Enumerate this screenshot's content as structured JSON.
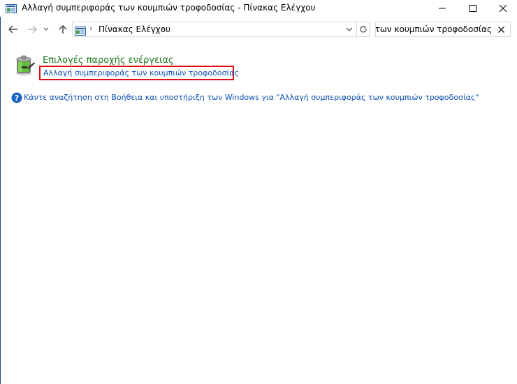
{
  "window": {
    "title": "Αλλαγή συμπεριφοράς των κουμπιών τροφοδοσίας - Πίνακας Ελέγχου",
    "icon": "control-panel-icon"
  },
  "address_bar": {
    "separator": "›",
    "breadcrumb": "Πίνακας Ελέγχου",
    "icon": "control-panel-icon"
  },
  "search": {
    "value": "ς των κουμπιών τροφοδοσίας",
    "clear_icon": "close-icon"
  },
  "results": {
    "category_title": "Επιλογές παροχής ενέργειας",
    "category_icon": "battery-icon",
    "task_link": "Αλλαγή συμπεριφοράς των κουμπιών τροφοδοσίας"
  },
  "help": {
    "icon": "help-icon",
    "link": "Κάντε αναζήτηση στη Βοήθεια και υποστήριξη των Windows για \"Αλλαγή συμπεριφοράς των κουμπιών τροφοδοσίας\""
  },
  "colors": {
    "category_title": "#1e7a1e",
    "link": "#0b4fb4",
    "highlight_box": "#e30613",
    "window_edge": "#1f3f7a"
  }
}
